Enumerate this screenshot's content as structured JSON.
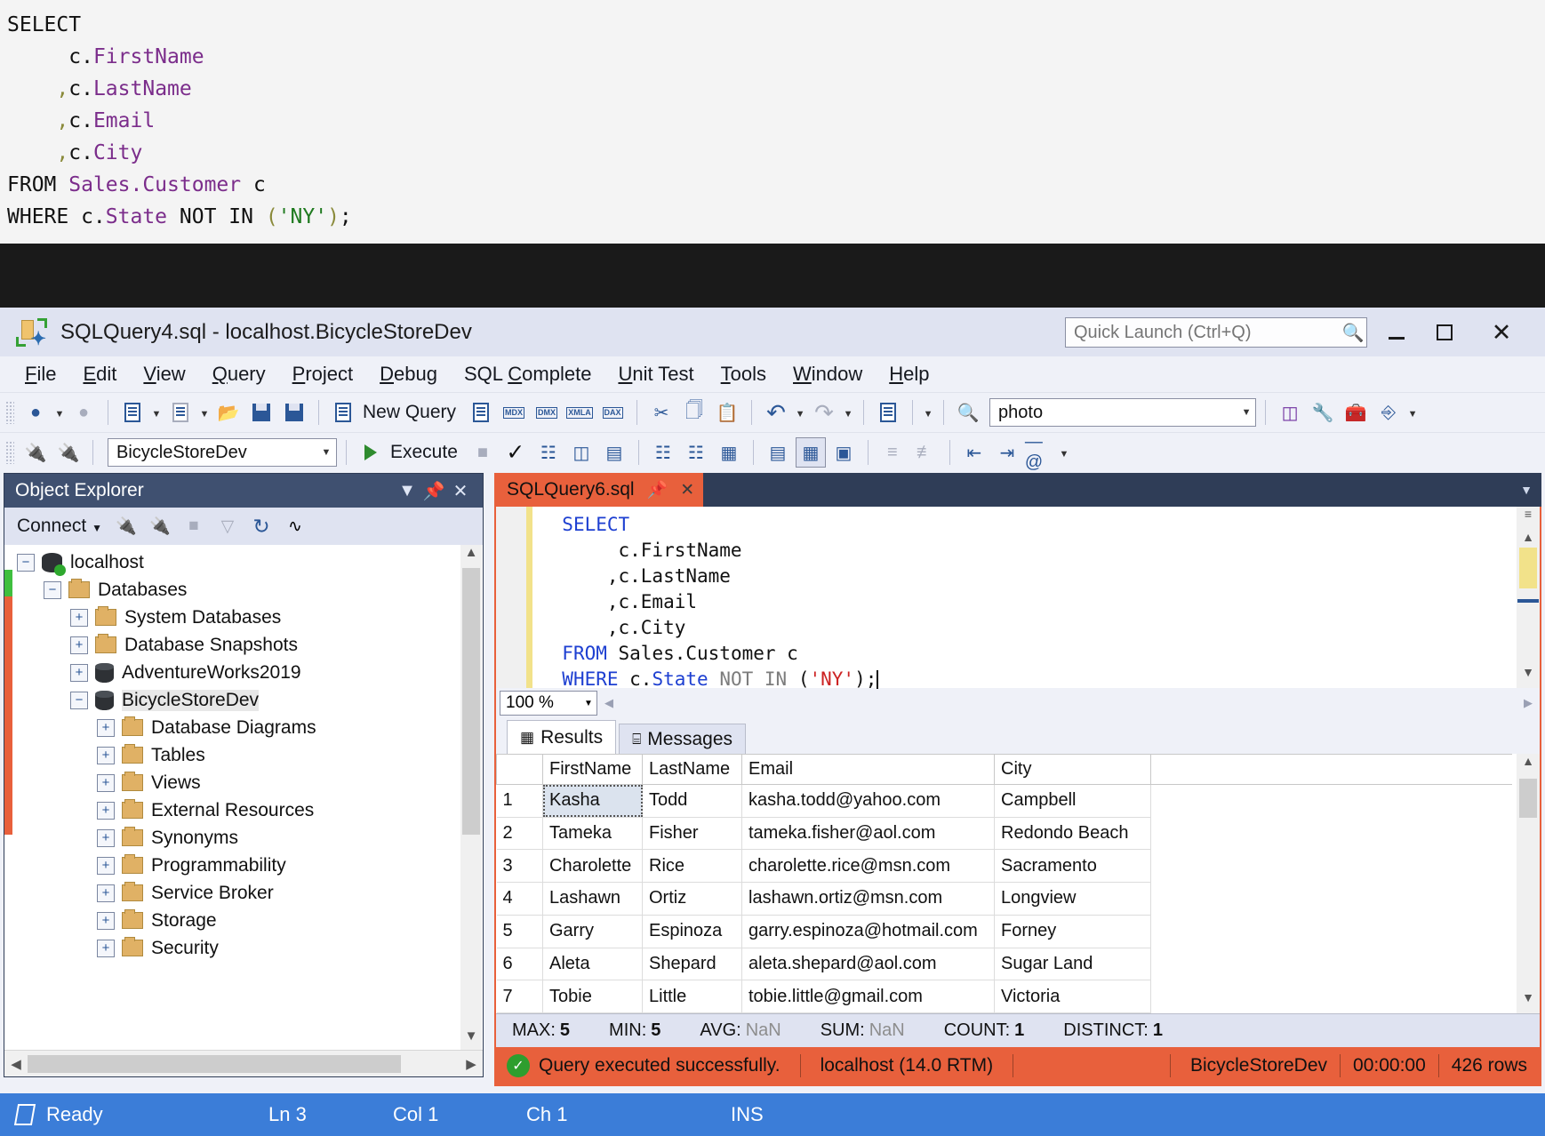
{
  "top_code": {
    "lines": [
      {
        "segs": [
          {
            "t": "SELECT",
            "c": "plain"
          }
        ]
      },
      {
        "segs": [
          {
            "t": "    ",
            "c": "plain"
          },
          {
            "t": " c.",
            "c": "plain"
          },
          {
            "t": "FirstName",
            "c": "ident"
          }
        ]
      },
      {
        "segs": [
          {
            "t": "    ",
            "c": "plain"
          },
          {
            "t": ",",
            "c": "comma"
          },
          {
            "t": "c.",
            "c": "plain"
          },
          {
            "t": "LastName",
            "c": "ident"
          }
        ]
      },
      {
        "segs": [
          {
            "t": "    ",
            "c": "plain"
          },
          {
            "t": ",",
            "c": "comma"
          },
          {
            "t": "c.",
            "c": "plain"
          },
          {
            "t": "Email",
            "c": "ident"
          }
        ]
      },
      {
        "segs": [
          {
            "t": "    ",
            "c": "plain"
          },
          {
            "t": ",",
            "c": "comma"
          },
          {
            "t": "c.",
            "c": "plain"
          },
          {
            "t": "City",
            "c": "ident"
          }
        ]
      },
      {
        "segs": [
          {
            "t": "FROM ",
            "c": "plain"
          },
          {
            "t": "Sales.Customer",
            "c": "ident"
          },
          {
            "t": " c",
            "c": "plain"
          }
        ]
      },
      {
        "segs": [
          {
            "t": "WHERE c.",
            "c": "plain"
          },
          {
            "t": "State",
            "c": "ident"
          },
          {
            "t": " NOT IN ",
            "c": "plain"
          },
          {
            "t": "(",
            "c": "comma"
          },
          {
            "t": "'NY'",
            "c": "str"
          },
          {
            "t": ")",
            "c": "comma"
          },
          {
            "t": ";",
            "c": "plain"
          }
        ]
      }
    ]
  },
  "window": {
    "title": "SQLQuery4.sql - localhost.BicycleStoreDev",
    "app_icon": "sql-file-icon",
    "quick_launch_placeholder": "Quick Launch (Ctrl+Q)",
    "quick_launch_value": "",
    "minimize_label": "Minimize",
    "maximize_label": "Maximize",
    "close_label": "✕"
  },
  "menu": {
    "items": [
      {
        "label": "File",
        "accel": "F"
      },
      {
        "label": "Edit",
        "accel": "E"
      },
      {
        "label": "View",
        "accel": "V"
      },
      {
        "label": "Query",
        "accel": "Q"
      },
      {
        "label": "Project",
        "accel": "P"
      },
      {
        "label": "Debug",
        "accel": "D"
      },
      {
        "label": "SQL Complete",
        "accel": "C"
      },
      {
        "label": "Unit Test",
        "accel": "U"
      },
      {
        "label": "Tools",
        "accel": "T"
      },
      {
        "label": "Window",
        "accel": "W"
      },
      {
        "label": "Help",
        "accel": "H"
      }
    ]
  },
  "toolbar1": {
    "new_query_label": "New Query",
    "find_value": "photo",
    "items": [
      {
        "name": "navigate-back-icon"
      },
      {
        "name": "navigate-forward-icon"
      },
      {
        "name": "new-project-icon"
      },
      {
        "name": "new-item-icon"
      },
      {
        "name": "open-file-icon"
      },
      {
        "name": "save-icon"
      },
      {
        "name": "save-all-icon"
      },
      {
        "name": "new-query-icon"
      },
      {
        "name": "new-analysis-query-icon"
      },
      {
        "name": "mdx-query-icon",
        "text": "MDX"
      },
      {
        "name": "dmx-query-icon",
        "text": "DMX"
      },
      {
        "name": "xmla-query-icon",
        "text": "XMLA"
      },
      {
        "name": "dax-query-icon",
        "text": "DAX"
      },
      {
        "name": "cut-icon"
      },
      {
        "name": "copy-icon"
      },
      {
        "name": "paste-icon"
      },
      {
        "name": "undo-icon"
      },
      {
        "name": "redo-icon"
      },
      {
        "name": "summary-icon"
      },
      {
        "name": "find-in-files-icon"
      },
      {
        "name": "registered-servers-icon"
      },
      {
        "name": "properties-icon"
      },
      {
        "name": "toolbox-icon"
      },
      {
        "name": "command-prompt-icon"
      }
    ]
  },
  "toolbar2": {
    "database_value": "BicycleStoreDev",
    "execute_label": "Execute",
    "execute_accel": "x",
    "items": [
      {
        "name": "connect-icon"
      },
      {
        "name": "disconnect-icon"
      },
      {
        "name": "execute-icon"
      },
      {
        "name": "stop-icon"
      },
      {
        "name": "parse-icon"
      },
      {
        "name": "display-estimated-plan-icon"
      },
      {
        "name": "include-actual-plan-icon"
      },
      {
        "name": "include-client-statistics-icon"
      },
      {
        "name": "results-to-text-icon"
      },
      {
        "name": "results-to-grid-icon"
      },
      {
        "name": "results-to-file-icon"
      },
      {
        "name": "comment-icon"
      },
      {
        "name": "uncomment-icon"
      },
      {
        "name": "decrease-indent-icon"
      },
      {
        "name": "increase-indent-icon"
      },
      {
        "name": "specify-values-icon"
      }
    ]
  },
  "object_explorer": {
    "title": "Object Explorer",
    "connect_label": "Connect",
    "toolbar_icons": [
      "connect-icon",
      "disconnect-icon",
      "stop-icon",
      "filter-icon",
      "refresh-icon",
      "activity-monitor-icon"
    ],
    "header_icons": [
      "chevron-down-icon",
      "pin-icon",
      "close-icon"
    ],
    "tree": [
      {
        "label": "localhost",
        "depth": 0,
        "expander": "minus",
        "icon": "server-icon",
        "selected": false
      },
      {
        "label": "Databases",
        "depth": 1,
        "expander": "minus",
        "icon": "folder-icon",
        "selected": false
      },
      {
        "label": "System Databases",
        "depth": 2,
        "expander": "plus",
        "icon": "folder-icon",
        "selected": false
      },
      {
        "label": "Database Snapshots",
        "depth": 2,
        "expander": "plus",
        "icon": "folder-icon",
        "selected": false
      },
      {
        "label": "AdventureWorks2019",
        "depth": 2,
        "expander": "plus",
        "icon": "database-icon",
        "selected": false
      },
      {
        "label": "BicycleStoreDev",
        "depth": 2,
        "expander": "minus",
        "icon": "database-icon",
        "selected": true
      },
      {
        "label": "Database Diagrams",
        "depth": 3,
        "expander": "plus",
        "icon": "folder-icon",
        "selected": false
      },
      {
        "label": "Tables",
        "depth": 3,
        "expander": "plus",
        "icon": "folder-icon",
        "selected": false
      },
      {
        "label": "Views",
        "depth": 3,
        "expander": "plus",
        "icon": "folder-icon",
        "selected": false
      },
      {
        "label": "External Resources",
        "depth": 3,
        "expander": "plus",
        "icon": "folder-icon",
        "selected": false
      },
      {
        "label": "Synonyms",
        "depth": 3,
        "expander": "plus",
        "icon": "folder-icon",
        "selected": false
      },
      {
        "label": "Programmability",
        "depth": 3,
        "expander": "plus",
        "icon": "folder-icon",
        "selected": false
      },
      {
        "label": "Service Broker",
        "depth": 3,
        "expander": "plus",
        "icon": "folder-icon",
        "selected": false
      },
      {
        "label": "Storage",
        "depth": 3,
        "expander": "plus",
        "icon": "folder-icon",
        "selected": false
      },
      {
        "label": "Security",
        "depth": 3,
        "expander": "plus",
        "icon": "folder-icon",
        "selected": false
      }
    ]
  },
  "editor": {
    "tab_label": "SQLQuery6.sql",
    "tab_pin_icon": "pin-icon",
    "tab_close_icon": "close-icon",
    "zoom_value": "100 %",
    "lines": [
      {
        "segs": [
          {
            "t": "  ",
            "c": "plain"
          },
          {
            "t": "SELECT",
            "c": "kw"
          }
        ]
      },
      {
        "segs": [
          {
            "t": "       c.FirstName",
            "c": "plain"
          }
        ]
      },
      {
        "segs": [
          {
            "t": "      ,c.LastName",
            "c": "plain"
          }
        ]
      },
      {
        "segs": [
          {
            "t": "      ,c.Email",
            "c": "plain"
          }
        ]
      },
      {
        "segs": [
          {
            "t": "      ,c.City",
            "c": "plain"
          }
        ]
      },
      {
        "segs": [
          {
            "t": "  ",
            "c": "plain"
          },
          {
            "t": "FROM",
            "c": "kw"
          },
          {
            "t": " Sales.Customer c",
            "c": "plain"
          }
        ]
      },
      {
        "segs": [
          {
            "t": "  ",
            "c": "plain"
          },
          {
            "t": "WHERE",
            "c": "kw"
          },
          {
            "t": " c.",
            "c": "plain"
          },
          {
            "t": "State",
            "c": "kw"
          },
          {
            "t": " NOT IN ",
            "c": "gray"
          },
          {
            "t": "(",
            "c": "plain"
          },
          {
            "t": "'NY'",
            "c": "str"
          },
          {
            "t": ");",
            "c": "plain"
          }
        ]
      }
    ]
  },
  "results": {
    "tabs": [
      {
        "label": "Results",
        "icon": "grid-icon",
        "active": true
      },
      {
        "label": "Messages",
        "icon": "message-icon",
        "active": false
      }
    ],
    "columns": [
      "",
      "FirstName",
      "LastName",
      "Email",
      "City"
    ],
    "rows": [
      {
        "n": "1",
        "FirstName": "Kasha",
        "LastName": "Todd",
        "Email": "kasha.todd@yahoo.com",
        "City": "Campbell",
        "selected": true
      },
      {
        "n": "2",
        "FirstName": "Tameka",
        "LastName": "Fisher",
        "Email": "tameka.fisher@aol.com",
        "City": "Redondo Beach",
        "selected": false
      },
      {
        "n": "3",
        "FirstName": "Charolette",
        "LastName": "Rice",
        "Email": "charolette.rice@msn.com",
        "City": "Sacramento",
        "selected": false
      },
      {
        "n": "4",
        "FirstName": "Lashawn",
        "LastName": "Ortiz",
        "Email": "lashawn.ortiz@msn.com",
        "City": "Longview",
        "selected": false
      },
      {
        "n": "5",
        "FirstName": "Garry",
        "LastName": "Espinoza",
        "Email": "garry.espinoza@hotmail.com",
        "City": "Forney",
        "selected": false
      },
      {
        "n": "6",
        "FirstName": "Aleta",
        "LastName": "Shepard",
        "Email": "aleta.shepard@aol.com",
        "City": "Sugar Land",
        "selected": false
      },
      {
        "n": "7",
        "FirstName": "Tobie",
        "LastName": "Little",
        "Email": "tobie.little@gmail.com",
        "City": "Victoria",
        "selected": false
      }
    ],
    "stats": [
      {
        "label": "MAX:",
        "value": "5",
        "nan": false
      },
      {
        "label": "MIN:",
        "value": "5",
        "nan": false
      },
      {
        "label": "AVG:",
        "value": "NaN",
        "nan": true
      },
      {
        "label": "SUM:",
        "value": "NaN",
        "nan": true
      },
      {
        "label": "COUNT:",
        "value": "1",
        "nan": false
      },
      {
        "label": "DISTINCT:",
        "value": "1",
        "nan": false
      }
    ],
    "status": {
      "icon": "success-icon",
      "message": "Query executed successfully.",
      "server": "localhost (14.0 RTM)",
      "user": "",
      "database": "BicycleStoreDev",
      "elapsed": "00:00:00",
      "rows": "426 rows"
    }
  },
  "statusbar": {
    "ready": "Ready",
    "line": "Ln 3",
    "col": "Col 1",
    "ch": "Ch 1",
    "mode": "INS"
  },
  "colors": {
    "accent_orange": "#e8603c",
    "titlebar": "#dfe3f1",
    "oe_header": "#3f5070",
    "statusbar_blue": "#3b7dd8",
    "success_green": "#2e9e2e"
  }
}
